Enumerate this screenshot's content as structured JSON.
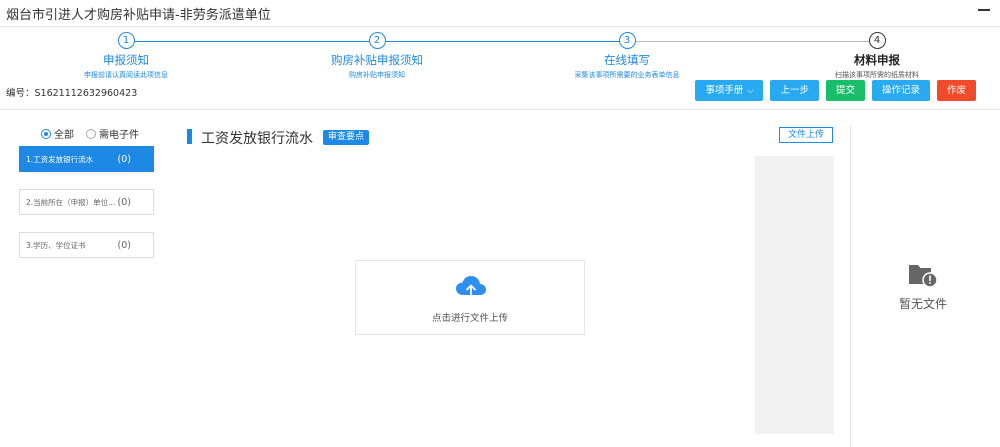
{
  "window": {
    "title": "烟台市引进人才购房补贴申请-非劳务派遣单位",
    "minimize_icon": "minimize-icon"
  },
  "steps": [
    {
      "num": "1",
      "title": "申报须知",
      "desc": "申报前请认真阅读此项信息"
    },
    {
      "num": "2",
      "title": "购房补贴申报须知",
      "desc": "购房补贴申报须知"
    },
    {
      "num": "3",
      "title": "在线填写",
      "desc": "采集该事项所需要的业务表单信息"
    },
    {
      "num": "4",
      "title": "材料申报",
      "desc": "扫描该事项所需的纸质材料"
    }
  ],
  "code_label": "编号：S1621112632960423",
  "actions": {
    "manual": "事项手册",
    "prev": "上一步",
    "submit": "提交",
    "log": "操作记录",
    "void": "作废"
  },
  "filter": {
    "all": "全部",
    "electronic": "需电子件",
    "selected": "all"
  },
  "materials": [
    {
      "name": "1.工资发放银行流水",
      "count": "(0)"
    },
    {
      "name": "2.当前所在（申报）单位...",
      "count": "(0)"
    },
    {
      "name": "3.学历、学位证书",
      "count": "(0)"
    }
  ],
  "section": {
    "title": "工资发放银行流水",
    "tag": "审查要点",
    "upload_btn": "文件上传"
  },
  "dropzone": {
    "text": "点击进行文件上传",
    "icon": "cloud-upload-icon"
  },
  "preview": {
    "empty_text": "暂无文件",
    "icon": "folder-alert-icon"
  },
  "colors": {
    "primary": "#1e88e5",
    "light_blue": "#29a9f0",
    "green": "#19be6b",
    "red": "#ef4a2a"
  }
}
